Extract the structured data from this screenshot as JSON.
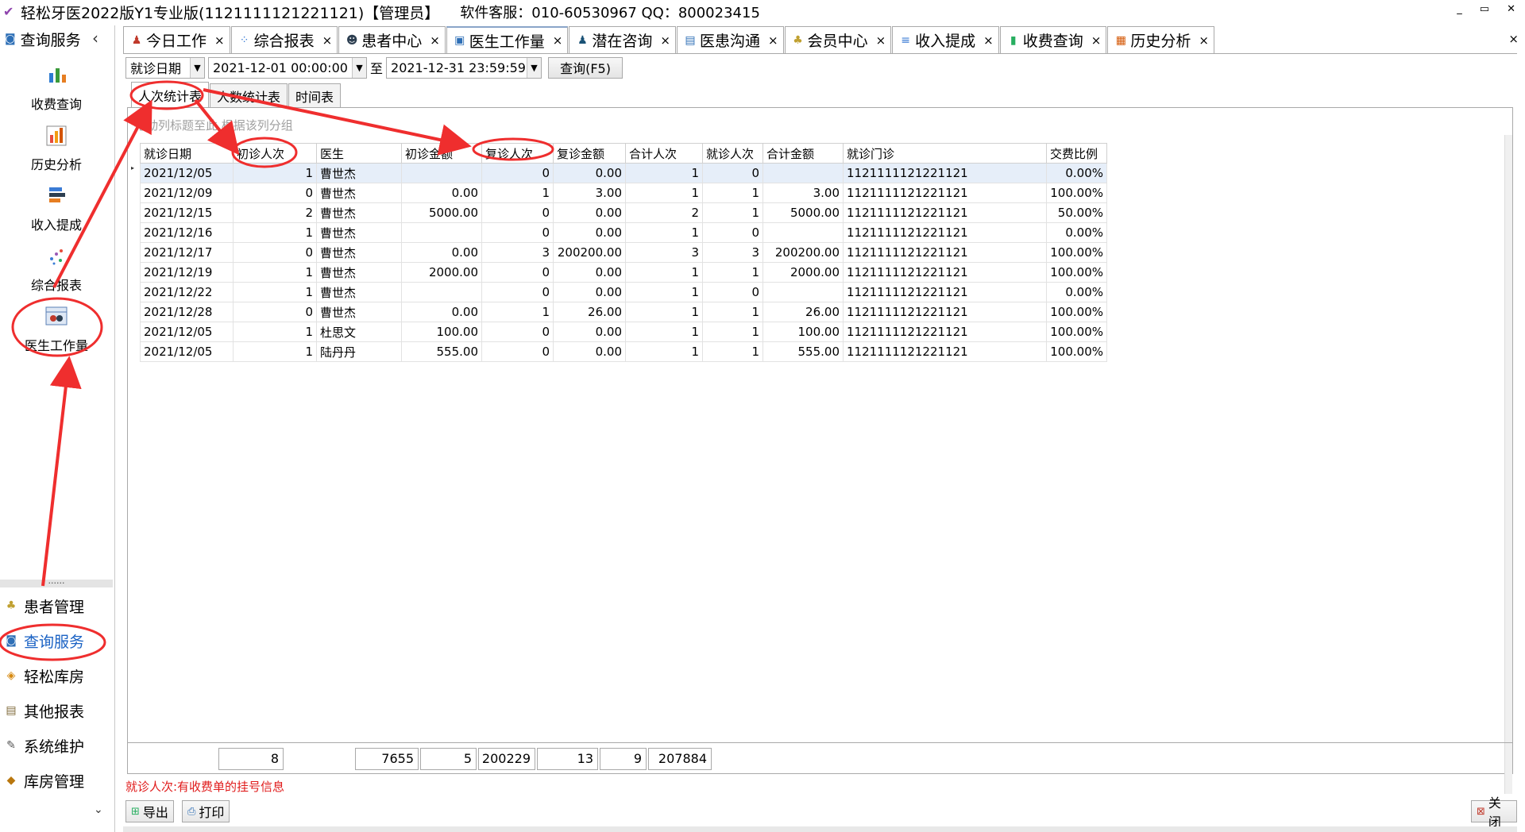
{
  "window": {
    "title": "轻松牙医2022版Y1专业版(1121111121221121)【管理员】",
    "support": "软件客服：010-60530967 QQ：800023415",
    "min": "_",
    "max": "▭",
    "close": "✕"
  },
  "leftpanel": {
    "header": "查询服务",
    "collapse": "‹",
    "tiles": [
      {
        "label": "收费查询"
      },
      {
        "label": "历史分析"
      },
      {
        "label": "收入提成"
      },
      {
        "label": "综合报表"
      },
      {
        "label": "医生工作量"
      }
    ],
    "sep": "......",
    "groups": [
      {
        "label": "患者管理",
        "icon": "people-icon"
      },
      {
        "label": "查询服务",
        "icon": "search-icon"
      },
      {
        "label": "轻松库房",
        "icon": "box-icon"
      },
      {
        "label": "其他报表",
        "icon": "report-icon"
      },
      {
        "label": "系统维护",
        "icon": "wrench-icon"
      },
      {
        "label": "库房管理",
        "icon": "storage-icon"
      }
    ],
    "more": "⌄"
  },
  "tabs": [
    {
      "label": "今日工作",
      "close": "×"
    },
    {
      "label": "综合报表",
      "close": "×"
    },
    {
      "label": "患者中心",
      "close": "×"
    },
    {
      "label": "医生工作量",
      "close": "×"
    },
    {
      "label": "潜在咨询",
      "close": "×"
    },
    {
      "label": "医患沟通",
      "close": "×"
    },
    {
      "label": "会员中心",
      "close": "×"
    },
    {
      "label": "收入提成",
      "close": "×"
    },
    {
      "label": "收费查询",
      "close": "×"
    },
    {
      "label": "历史分析",
      "close": "×"
    }
  ],
  "tabstrip_close": "×",
  "toolbar": {
    "date_type": "就诊日期",
    "start": "2021-12-01 00:00:00",
    "to": "至",
    "end": "2021-12-31 23:59:59",
    "query": "查询(F5)"
  },
  "subtabs": [
    "人次统计表",
    "人数统计表",
    "时间表"
  ],
  "grid": {
    "group_hint": "拖动列标题至此,根据该列分组",
    "columns": [
      "就诊日期",
      "初诊人次",
      "医生",
      "初诊金额",
      "复诊人次",
      "复诊金额",
      "合计人次",
      "就诊人次",
      "合计金额",
      "就诊门诊",
      "交费比例"
    ],
    "rows": [
      [
        "2021/12/05",
        "1",
        "曹世杰",
        "",
        "0",
        "0.00",
        "1",
        "0",
        "",
        "1121111121221121",
        "0.00%"
      ],
      [
        "2021/12/09",
        "0",
        "曹世杰",
        "0.00",
        "1",
        "3.00",
        "1",
        "1",
        "3.00",
        "1121111121221121",
        "100.00%"
      ],
      [
        "2021/12/15",
        "2",
        "曹世杰",
        "5000.00",
        "0",
        "0.00",
        "2",
        "1",
        "5000.00",
        "1121111121221121",
        "50.00%"
      ],
      [
        "2021/12/16",
        "1",
        "曹世杰",
        "",
        "0",
        "0.00",
        "1",
        "0",
        "",
        "1121111121221121",
        "0.00%"
      ],
      [
        "2021/12/17",
        "0",
        "曹世杰",
        "0.00",
        "3",
        "200200.00",
        "3",
        "3",
        "200200.00",
        "1121111121221121",
        "100.00%"
      ],
      [
        "2021/12/19",
        "1",
        "曹世杰",
        "2000.00",
        "0",
        "0.00",
        "1",
        "1",
        "2000.00",
        "1121111121221121",
        "100.00%"
      ],
      [
        "2021/12/22",
        "1",
        "曹世杰",
        "",
        "0",
        "0.00",
        "1",
        "0",
        "",
        "1121111121221121",
        "0.00%"
      ],
      [
        "2021/12/28",
        "0",
        "曹世杰",
        "0.00",
        "1",
        "26.00",
        "1",
        "1",
        "26.00",
        "1121111121221121",
        "100.00%"
      ],
      [
        "2021/12/05",
        "1",
        "杜思文",
        "100.00",
        "0",
        "0.00",
        "1",
        "1",
        "100.00",
        "1121111121221121",
        "100.00%"
      ],
      [
        "2021/12/05",
        "1",
        "陆丹丹",
        "555.00",
        "0",
        "0.00",
        "1",
        "1",
        "555.00",
        "1121111121221121",
        "100.00%"
      ]
    ],
    "totals": [
      "8",
      "7655",
      "5",
      "200229",
      "13",
      "9",
      "207884"
    ]
  },
  "note": "就诊人次:有收费单的挂号信息",
  "bottom": {
    "export": "导出",
    "print": "打印",
    "close": "关闭"
  },
  "colors": {
    "accent": "#1a62c4",
    "annotation": "#ef2e2e",
    "note": "#e01b1b"
  }
}
